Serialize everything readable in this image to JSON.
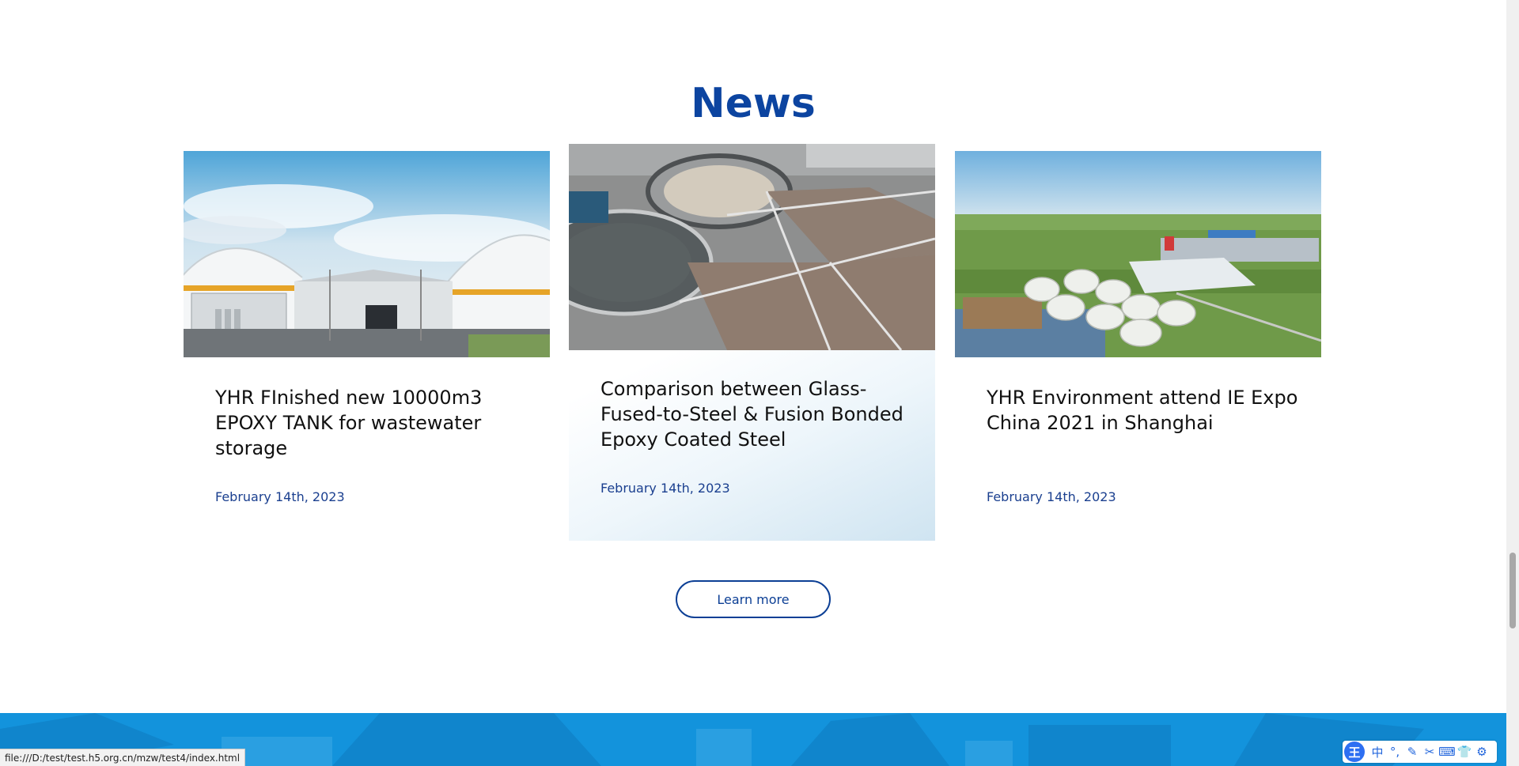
{
  "section": {
    "title": "News"
  },
  "news": [
    {
      "title": "YHR FInished new 10000m3 EPOXY TANK for wastewater storage",
      "date": "February 14th, 2023",
      "image": "biogas-domes-photo"
    },
    {
      "title": "Comparison between Glass-Fused-to-Steel & Fusion Bonded Epoxy Coated Steel",
      "date": "February 14th, 2023",
      "image": "wastewater-treatment-plant-photo"
    },
    {
      "title": "YHR Environment attend IE Expo China 2021 in Shanghai",
      "date": "February 14th, 2023",
      "image": "aerial-tank-farm-photo"
    }
  ],
  "learn_more": "Learn more",
  "status_bar": {
    "url": "file:///D:/test/test.h5.org.cn/mzw/test4/index.html"
  },
  "ime_toolbar": {
    "logo": "王",
    "buttons": [
      {
        "glyph": "中",
        "icon": "chinese-mode-icon"
      },
      {
        "glyph": "°,",
        "icon": "punctuation-icon"
      },
      {
        "glyph": "✎",
        "icon": "handwriting-icon"
      },
      {
        "glyph": "✂",
        "icon": "scissors-icon"
      },
      {
        "glyph": "⌨",
        "icon": "keyboard-icon"
      },
      {
        "glyph": "👕",
        "icon": "skin-icon"
      },
      {
        "glyph": "⚙",
        "icon": "gear-icon"
      }
    ]
  },
  "colors": {
    "title_blue": "#0c44a0",
    "date_blue": "#1a3f8f",
    "band_blue": "#1393dc"
  }
}
